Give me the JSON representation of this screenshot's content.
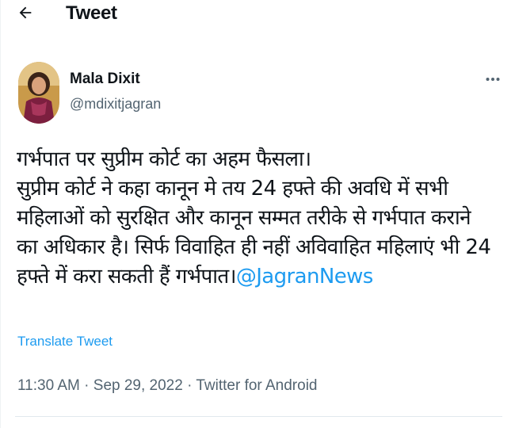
{
  "header": {
    "back_icon": "arrow-left-icon",
    "title": "Tweet"
  },
  "author": {
    "name": "Mala Dixit",
    "handle": "@mdixitjagran"
  },
  "more_icon": "more-horizontal-icon",
  "tweet": {
    "lines": [
      "गर्भपात पर सुप्रीम कोर्ट का अहम फैसला।",
      "सुप्रीम कोर्ट ने कहा कानून मे तय 24 हफ्ते की अवधि में  सभी",
      "महिलाओं को सुरक्षित और कानून सम्मत तरीके से गर्भपात कराने",
      "का अधिकार है। सिर्फ विवाहित ही नहीं अविवाहित महिलाएं भी 24"
    ],
    "last_line": "हफ्ते में करा सकती हैं गर्भपात।",
    "mention": "@JagranNews"
  },
  "translate_label": "Translate Tweet",
  "meta": {
    "time": "11:30 AM",
    "sep1": " · ",
    "date": "Sep 29, 2022",
    "sep2": " · ",
    "source": "Twitter for Android"
  },
  "colors": {
    "link": "#1d9bf0",
    "secondary_text": "#536471",
    "primary_text": "#0f1419"
  }
}
